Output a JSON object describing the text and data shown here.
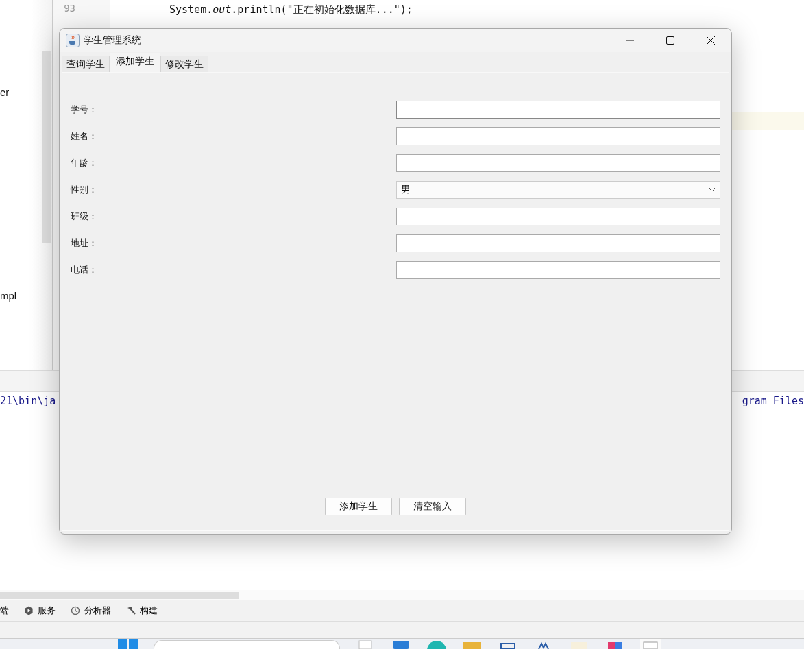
{
  "editor": {
    "line_number": "93",
    "code": "System.*out*.println(\"正在初始化数据库...\");"
  },
  "project_items": [
    "er",
    "mpl"
  ],
  "console": {
    "left_text": "21\\bin\\ja",
    "right_text": "gram Files"
  },
  "tool_tabs": [
    {
      "label": "端",
      "kind": "none"
    },
    {
      "label": "服务",
      "kind": "service"
    },
    {
      "label": "分析器",
      "kind": "profiler"
    },
    {
      "label": "构建",
      "kind": "build"
    }
  ],
  "dialog": {
    "title": "学生管理系统",
    "tabs": [
      {
        "label": "查询学生",
        "selected": false
      },
      {
        "label": "添加学生",
        "selected": true
      },
      {
        "label": "修改学生",
        "selected": false
      }
    ],
    "fields": [
      {
        "label": "学号：",
        "kind": "text",
        "focused": true
      },
      {
        "label": "姓名：",
        "kind": "text",
        "focused": false
      },
      {
        "label": "年龄：",
        "kind": "text",
        "focused": false
      },
      {
        "label": "性别：",
        "kind": "select",
        "value": "男"
      },
      {
        "label": "班级：",
        "kind": "text",
        "focused": false
      },
      {
        "label": "地址：",
        "kind": "text",
        "focused": false
      },
      {
        "label": "电话：",
        "kind": "text",
        "focused": false
      }
    ],
    "buttons": [
      "添加学生",
      "清空输入"
    ]
  }
}
